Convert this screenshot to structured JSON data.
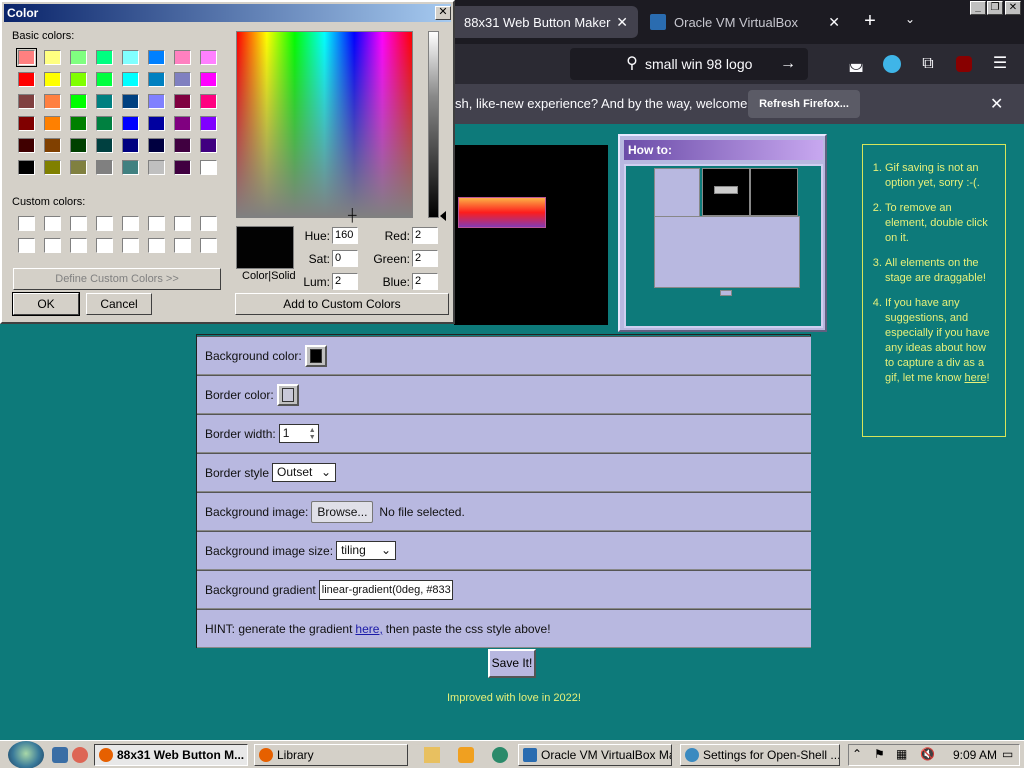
{
  "browser": {
    "tabs": [
      {
        "title": "88x31 Web Button Maker",
        "active": true
      },
      {
        "title": "Oracle VM VirtualBox",
        "active": false
      }
    ],
    "url_text": "small win 98 logo",
    "notice_text": "sh, like-new experience? And by the way, welcome back!",
    "notice_button": "Refresh Firefox..."
  },
  "page": {
    "howto_title": "How to:",
    "tips": [
      "Gif saving is not an option yet, sorry :-(.",
      "To remove an element, double click on it.",
      "All elements on the stage are draggable!",
      "If you have any suggestions, and especially if you have any ideas about how to capture a div as a gif, let me know "
    ],
    "tips_link": "here",
    "settings": {
      "bg_color_label": "Background color:",
      "border_color_label": "Border color:",
      "border_width_label": "Border width:",
      "border_width_value": "1",
      "border_style_label": "Border style",
      "border_style_value": "Outset",
      "bg_image_label": "Background image:",
      "browse_label": "Browse...",
      "no_file_label": "No file selected.",
      "bg_image_size_label": "Background image size:",
      "bg_image_size_value": "tiling",
      "bg_gradient_label": "Background gradient",
      "bg_gradient_value": "linear-gradient(0deg, #833",
      "hint_prefix": "HINT: generate the gradient",
      "hint_link": "here,",
      "hint_suffix": "then paste the css style above!"
    },
    "save_button": "Save It!",
    "footer": "Improved with love in 2022!"
  },
  "dialog": {
    "title": "Color",
    "basic_colors_label": "Basic colors:",
    "custom_colors_label": "Custom colors:",
    "define_custom_button": "Define Custom Colors >>",
    "ok_button": "OK",
    "cancel_button": "Cancel",
    "add_custom_button": "Add to Custom Colors",
    "color_solid_label": "Color|Solid",
    "fields": {
      "hue_label": "Hue:",
      "hue": "160",
      "sat_label": "Sat:",
      "sat": "0",
      "lum_label": "Lum:",
      "lum": "2",
      "red_label": "Red:",
      "red": "2",
      "green_label": "Green:",
      "green": "2",
      "blue_label": "Blue:",
      "blue": "2"
    },
    "basic_colors": [
      "#ff8080",
      "#ffff80",
      "#80ff80",
      "#00ff80",
      "#80ffff",
      "#0080ff",
      "#ff80c0",
      "#ff80ff",
      "#ff0000",
      "#ffff00",
      "#80ff00",
      "#00ff40",
      "#00ffff",
      "#0080c0",
      "#8080c0",
      "#ff00ff",
      "#804040",
      "#ff8040",
      "#00ff00",
      "#008080",
      "#004080",
      "#8080ff",
      "#800040",
      "#ff0080",
      "#800000",
      "#ff8000",
      "#008000",
      "#008040",
      "#0000ff",
      "#0000a0",
      "#800080",
      "#8000ff",
      "#400000",
      "#804000",
      "#004000",
      "#004040",
      "#000080",
      "#000040",
      "#400040",
      "#400080",
      "#000000",
      "#808000",
      "#808040",
      "#808080",
      "#408080",
      "#c0c0c0",
      "#400040",
      "#ffffff"
    ]
  },
  "taskbar": {
    "buttons": [
      {
        "label": "88x31 Web Button M...",
        "active": true
      },
      {
        "label": "Library",
        "active": false
      },
      {
        "label": "Oracle VM VirtualBox Ma...",
        "active": false
      },
      {
        "label": "Settings for Open-Shell ...",
        "active": false
      }
    ],
    "clock": "9:09 AM"
  }
}
